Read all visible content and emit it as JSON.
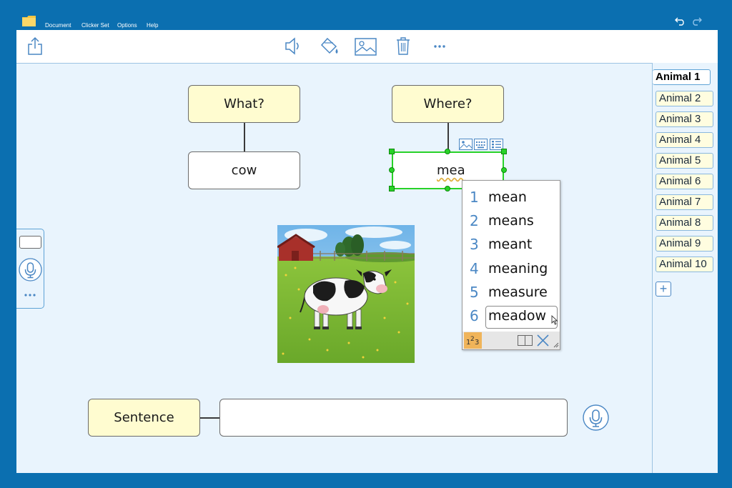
{
  "menu": {
    "items": [
      "Document",
      "Clicker Set",
      "Options",
      "Help"
    ]
  },
  "colors": {
    "frame": "#0b6fb0",
    "canvas": "#e9f4fd",
    "prompt_box": "#fffcd0",
    "selection": "#28d228",
    "accent": "#4a87c4"
  },
  "toolbar": {
    "icons": [
      "share-icon",
      "speaker-icon",
      "fill-icon",
      "picture-icon",
      "trash-icon",
      "more-icon"
    ]
  },
  "frame": {
    "what_label": "What?",
    "what_answer": "cow",
    "where_label": "Where?",
    "where_answer": "mea",
    "sentence_label": "Sentence",
    "sentence_value": ""
  },
  "predictions": {
    "items": [
      {
        "num": "1",
        "word": "mean"
      },
      {
        "num": "2",
        "word": "means"
      },
      {
        "num": "3",
        "word": "meant"
      },
      {
        "num": "4",
        "word": "meaning"
      },
      {
        "num": "5",
        "word": "measure"
      },
      {
        "num": "6",
        "word": "meadow"
      }
    ],
    "selected_index": 6
  },
  "tabs": {
    "items": [
      "Animal 1",
      "Animal 2",
      "Animal 3",
      "Animal 4",
      "Animal 5",
      "Animal 6",
      "Animal 7",
      "Animal 8",
      "Animal 9",
      "Animal 10"
    ],
    "active": "Animal 1",
    "add_label": "+"
  },
  "image": {
    "subject": "cow-in-meadow-picture"
  }
}
